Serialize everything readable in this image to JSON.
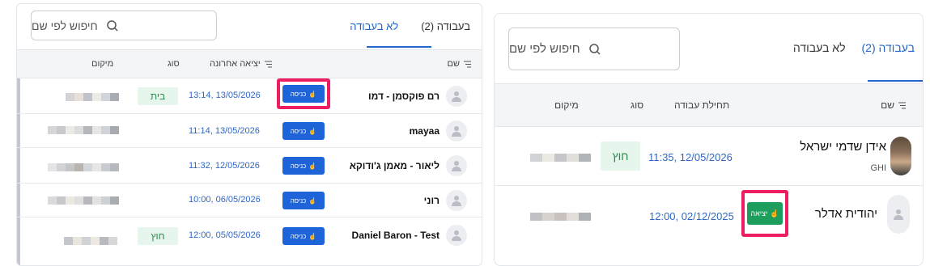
{
  "left_panel": {
    "tabs": [
      {
        "label": "בעבודה (2)",
        "active": false
      },
      {
        "label": "לא בעבודה",
        "active": true
      }
    ],
    "search": {
      "placeholder": "חיפוש לפי שם"
    },
    "columns": {
      "name": "שם",
      "last_exit": "יציאה אחרונה",
      "type": "סוג",
      "location": "מיקום"
    },
    "rows": [
      {
        "name": "רם פוקסמן - דמו",
        "action": "כניסה",
        "time": "13:14, 13/05/2026",
        "type": "בית",
        "highlighted": true
      },
      {
        "name": "mayaa",
        "action": "כניסה",
        "time": "11:14, 13/05/2026",
        "type": ""
      },
      {
        "name": "ליאור - מאמן ג'ודוקא",
        "action": "כניסה",
        "time": "11:32, 12/05/2026",
        "type": ""
      },
      {
        "name": "רוני",
        "action": "כניסה",
        "time": "10:00, 06/05/2026",
        "type": ""
      },
      {
        "name": "Daniel Baron - Test",
        "action": "כניסה",
        "time": "12:00, 05/05/2026",
        "type": "חוץ"
      }
    ]
  },
  "right_panel": {
    "tabs": [
      {
        "label": "בעבודה (2)",
        "active": true
      },
      {
        "label": "לא בעבודה",
        "active": false
      }
    ],
    "search": {
      "placeholder": "חיפוש לפי שם"
    },
    "columns": {
      "name": "שם",
      "work_start": "תחילת עבודה",
      "type": "סוג",
      "location": "מיקום"
    },
    "rows": [
      {
        "name": "אידן שדמי ישראל",
        "subtitle": "GHI",
        "time": "11:35, 12/05/2026",
        "type": "חוץ",
        "action": ""
      },
      {
        "name": "יהודית אדלר",
        "subtitle": "",
        "time": "12:00, 02/12/2025",
        "type": "",
        "action": "יציאה",
        "highlighted": true
      }
    ]
  },
  "colors": {
    "accent": "#2465c9",
    "enter_button": "#1f63d8",
    "exit_button": "#1e9e5c",
    "highlight": "#ee1d5f",
    "badge_bg": "#e6f6ec",
    "badge_text": "#2c8a50"
  },
  "icons": [
    "search-icon",
    "sort-icon",
    "user-icon",
    "finger-tap-icon"
  ]
}
